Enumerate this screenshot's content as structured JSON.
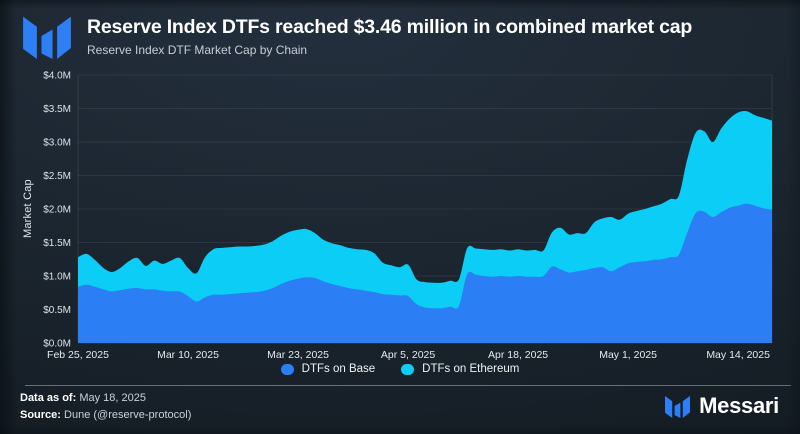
{
  "header": {
    "title": "Reserve Index DTFs reached $3.46 million in combined market cap",
    "subtitle": "Reserve Index DTF Market Cap by Chain"
  },
  "chart_data": {
    "type": "area",
    "stacked": true,
    "title": "Reserve Index DTF Market Cap by Chain",
    "xlabel": "",
    "ylabel": "Market Cap",
    "unit": "USD (millions)",
    "ylim": [
      0,
      4.0
    ],
    "y_ticks": [
      "$0.0M",
      "$0.5M",
      "$1.0M",
      "$1.5M",
      "$2.0M",
      "$2.5M",
      "$3.0M",
      "$3.5M",
      "$4.0M"
    ],
    "x_ticks": [
      {
        "day": 0,
        "label": "Feb 25, 2025"
      },
      {
        "day": 13,
        "label": "Mar 10, 2025"
      },
      {
        "day": 26,
        "label": "Mar 23, 2025"
      },
      {
        "day": 39,
        "label": "Apr 5, 2025"
      },
      {
        "day": 52,
        "label": "Apr 18, 2025"
      },
      {
        "day": 65,
        "label": "May 1, 2025"
      },
      {
        "day": 78,
        "label": "May 14, 2025"
      }
    ],
    "x_start_date": "Feb 25, 2025",
    "x_end_date": "May 18, 2025",
    "legend_position": "bottom",
    "grid": true,
    "max_total_market_cap_millions": 3.46,
    "series": [
      {
        "name": "DTFs on Base",
        "color": "#2b7ef3",
        "values": [
          0.84,
          0.87,
          0.84,
          0.8,
          0.77,
          0.79,
          0.81,
          0.82,
          0.8,
          0.8,
          0.78,
          0.77,
          0.77,
          0.7,
          0.62,
          0.68,
          0.72,
          0.72,
          0.73,
          0.74,
          0.75,
          0.76,
          0.78,
          0.82,
          0.88,
          0.93,
          0.96,
          0.98,
          0.97,
          0.92,
          0.88,
          0.85,
          0.82,
          0.8,
          0.78,
          0.76,
          0.73,
          0.72,
          0.71,
          0.7,
          0.58,
          0.53,
          0.52,
          0.52,
          0.54,
          0.55,
          1.03,
          1.02,
          1.0,
          0.99,
          1.0,
          0.99,
          1.0,
          0.99,
          0.99,
          1.0,
          1.14,
          1.1,
          1.05,
          1.07,
          1.09,
          1.12,
          1.13,
          1.07,
          1.13,
          1.19,
          1.21,
          1.22,
          1.24,
          1.25,
          1.28,
          1.32,
          1.65,
          1.94,
          1.96,
          1.88,
          1.95,
          2.02,
          2.05,
          2.08,
          2.05,
          2.01,
          1.99
        ]
      },
      {
        "name": "DTFs on Ethereum",
        "color": "#0bcdf5",
        "values": [
          0.44,
          0.46,
          0.4,
          0.32,
          0.29,
          0.33,
          0.41,
          0.45,
          0.35,
          0.43,
          0.4,
          0.46,
          0.5,
          0.42,
          0.42,
          0.6,
          0.68,
          0.7,
          0.7,
          0.7,
          0.69,
          0.69,
          0.69,
          0.7,
          0.72,
          0.73,
          0.73,
          0.72,
          0.67,
          0.62,
          0.61,
          0.61,
          0.6,
          0.6,
          0.61,
          0.58,
          0.47,
          0.44,
          0.42,
          0.47,
          0.37,
          0.38,
          0.38,
          0.38,
          0.39,
          0.4,
          0.39,
          0.39,
          0.4,
          0.4,
          0.4,
          0.39,
          0.4,
          0.39,
          0.4,
          0.38,
          0.51,
          0.62,
          0.57,
          0.57,
          0.55,
          0.68,
          0.73,
          0.81,
          0.71,
          0.74,
          0.76,
          0.78,
          0.8,
          0.83,
          0.87,
          0.88,
          1.1,
          1.2,
          1.2,
          1.12,
          1.25,
          1.33,
          1.39,
          1.38,
          1.35,
          1.35,
          1.33
        ]
      }
    ]
  },
  "footer": {
    "data_as_of_label": "Data as of:",
    "data_as_of_value": "May 18, 2025",
    "source_label": "Source:",
    "source_value": "Dune (@reserve-protocol)",
    "brand": "Messari"
  },
  "colors": {
    "base_area": "#2b7ef3",
    "ethereum_area": "#0bcdf5",
    "background_dark": "#161f29",
    "brand_blue": "#2e7ef5"
  }
}
